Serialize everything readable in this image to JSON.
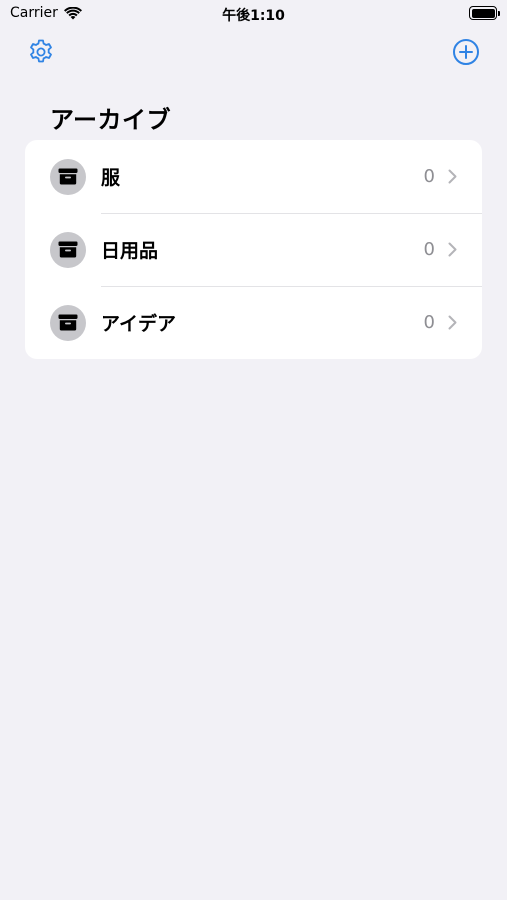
{
  "status_bar": {
    "carrier": "Carrier",
    "time": "午後1:10"
  },
  "nav": {
    "settings_icon": "gear-icon",
    "add_icon": "plus-circle-icon",
    "accent_color": "#2f83e4"
  },
  "title": "アーカイブ",
  "items": [
    {
      "label": "服",
      "count": "0",
      "icon": "archivebox-icon"
    },
    {
      "label": "日用品",
      "count": "0",
      "icon": "archivebox-icon"
    },
    {
      "label": "アイデア",
      "count": "0",
      "icon": "archivebox-icon"
    }
  ]
}
